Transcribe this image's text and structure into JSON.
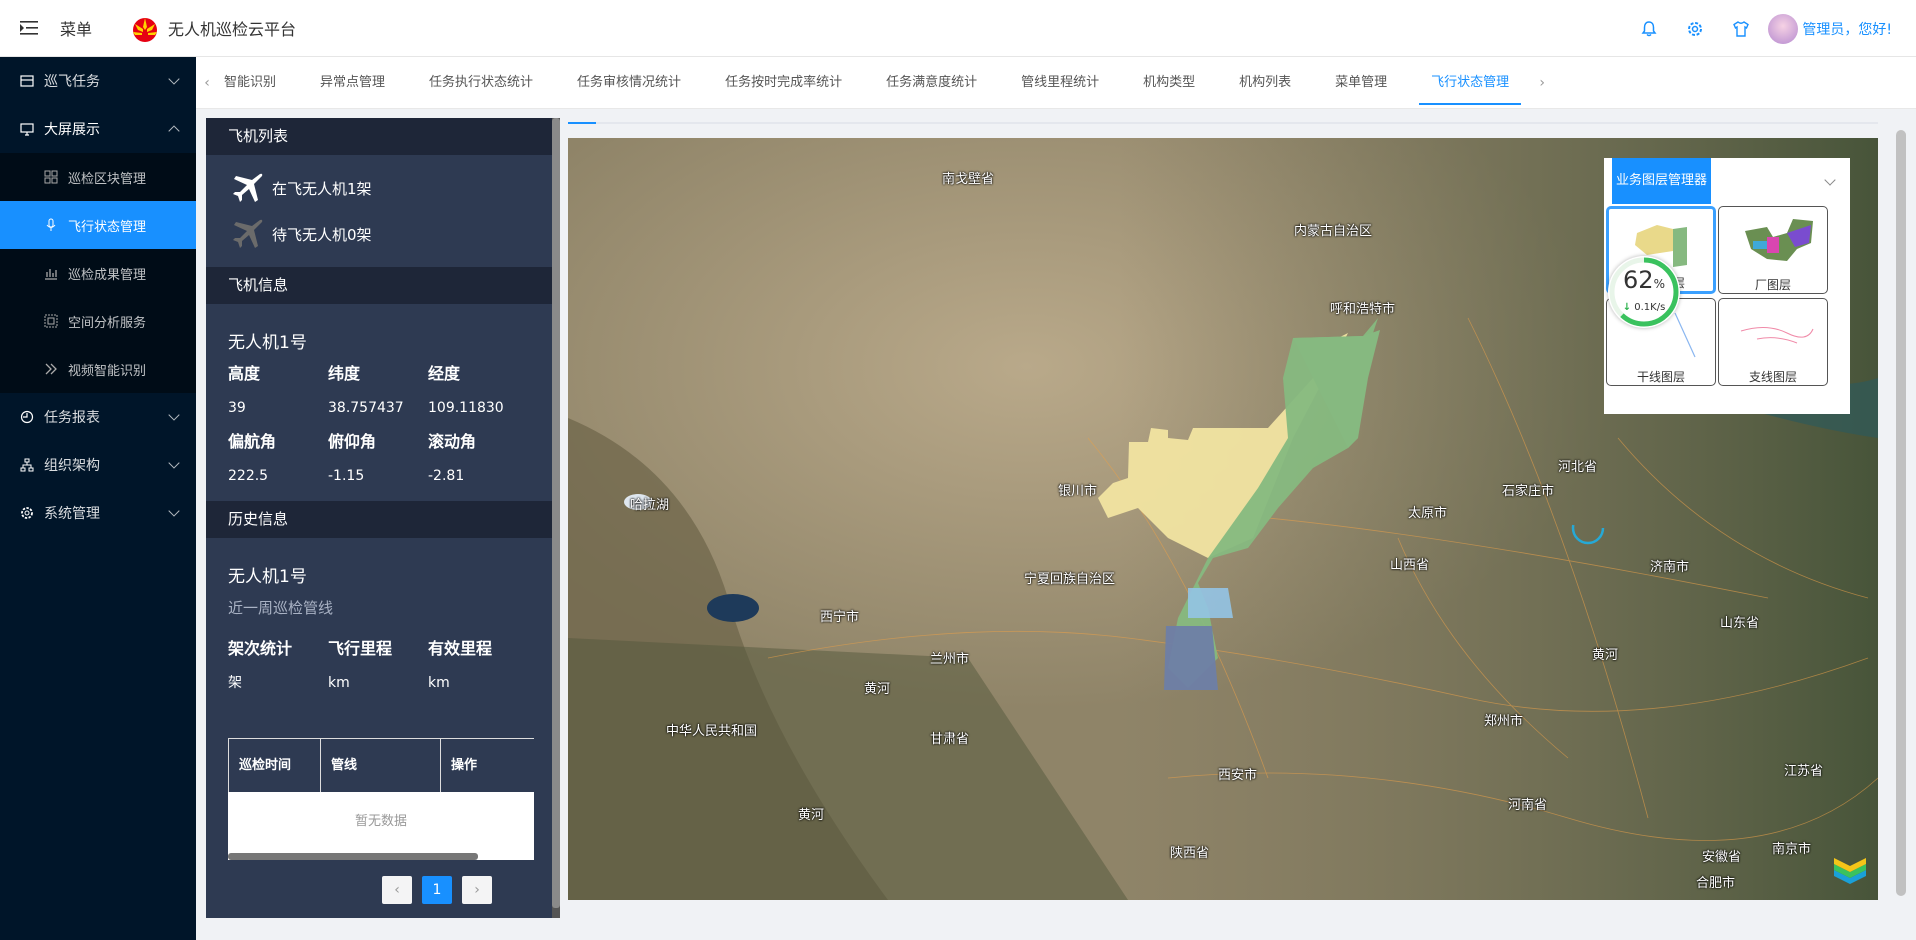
{
  "header": {
    "menu_label": "菜单",
    "title": "无人机巡检云平台",
    "user_label": "管理员，您好!"
  },
  "sidebar": {
    "items": [
      {
        "label": "巡飞任务",
        "icon": "plane-icon",
        "expanded": false
      },
      {
        "label": "大屏展示",
        "icon": "monitor-icon",
        "expanded": true
      },
      {
        "label": "任务报表",
        "icon": "report-icon",
        "expanded": false
      },
      {
        "label": "组织架构",
        "icon": "org-icon",
        "expanded": false
      },
      {
        "label": "系统管理",
        "icon": "gear-icon",
        "expanded": false
      }
    ],
    "sub_items": [
      {
        "label": "巡检区块管理",
        "icon": "grid-icon"
      },
      {
        "label": "飞行状态管理",
        "icon": "mic-icon",
        "active": true
      },
      {
        "label": "巡检成果管理",
        "icon": "bar-chart-icon"
      },
      {
        "label": "空间分析服务",
        "icon": "layers-icon"
      },
      {
        "label": "视频智能识别",
        "icon": "double-chevron-icon"
      }
    ]
  },
  "tabs": [
    {
      "label": "智能识别"
    },
    {
      "label": "异常点管理"
    },
    {
      "label": "任务执行状态统计"
    },
    {
      "label": "任务审核情况统计"
    },
    {
      "label": "任务按时完成率统计"
    },
    {
      "label": "任务满意度统计"
    },
    {
      "label": "管线里程统计"
    },
    {
      "label": "机构类型"
    },
    {
      "label": "机构列表"
    },
    {
      "label": "菜单管理"
    },
    {
      "label": "飞行状态管理",
      "active": true
    }
  ],
  "panel": {
    "plane_list_title": "飞机列表",
    "flying": "在飞无人机1架",
    "waiting": "待飞无人机0架",
    "plane_info_title": "飞机信息",
    "drone_name": "无人机1号",
    "fields": [
      {
        "k": "高度",
        "v": "39"
      },
      {
        "k": "纬度",
        "v": "38.757437"
      },
      {
        "k": "经度",
        "v": "109.11830"
      },
      {
        "k": "偏航角",
        "v": "222.5"
      },
      {
        "k": "俯仰角",
        "v": "-1.15"
      },
      {
        "k": "滚动角",
        "v": "-2.81"
      }
    ],
    "history_title": "历史信息",
    "history_drone": "无人机1号",
    "history_sub": "近一周巡检管线",
    "stats": [
      {
        "k": "架次统计",
        "v": "架"
      },
      {
        "k": "飞行里程",
        "v": "km"
      },
      {
        "k": "有效里程",
        "v": "km"
      }
    ],
    "table_headers": [
      "巡检时间",
      "管线",
      "操作"
    ],
    "empty_text": "暂无数据",
    "page_prev": "‹",
    "page_current": "1",
    "page_next": "›"
  },
  "map": {
    "labels": [
      "南戈壁省",
      "内蒙古自治区",
      "呼和浩特市",
      "银川市",
      "宁夏回族自治区",
      "太原市",
      "石家庄市",
      "河北省",
      "山西省",
      "济南市",
      "山东省",
      "西宁市",
      "兰州市",
      "甘肃省",
      "黄河",
      "中华人民共和国",
      "郑州市",
      "西安市",
      "河南省",
      "陕西省",
      "江苏省",
      "安徽省",
      "南京市",
      "合肥市",
      "哈拉湖",
      "黄河",
      "黄河"
    ]
  },
  "layer_manager": {
    "title": "业务图层管理器",
    "cards": [
      {
        "label": "区块图层",
        "selected": true
      },
      {
        "label": "厂图层"
      },
      {
        "label": "干线图层"
      },
      {
        "label": "支线图层"
      }
    ]
  },
  "network_gauge": {
    "percent": "62",
    "unit": "%",
    "speed": "0.1K/s"
  },
  "colors": {
    "primary": "#1890ff",
    "sidebar": "#001529",
    "panel": "#2e3a52"
  }
}
